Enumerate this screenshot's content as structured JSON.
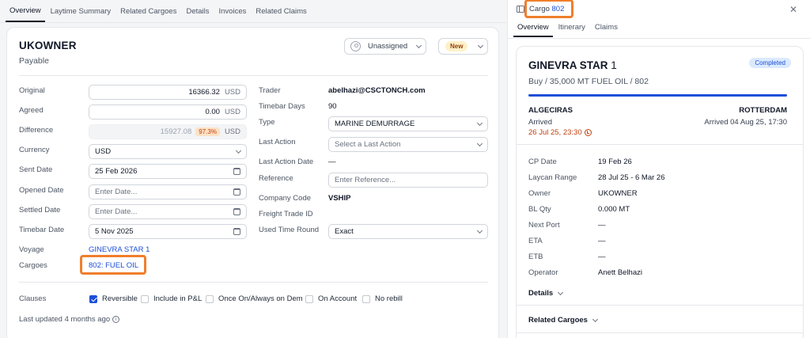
{
  "tabs": [
    "Overview",
    "Laytime Summary",
    "Related Cargoes",
    "Details",
    "Invoices",
    "Related Claims"
  ],
  "header": {
    "title": "UKOWNER",
    "subtitle": "Payable",
    "assignee": "Unassigned",
    "status": "New"
  },
  "form": {
    "original_label": "Original",
    "original_value": "16366.32",
    "original_unit": "USD",
    "agreed_label": "Agreed",
    "agreed_value": "0.00",
    "agreed_unit": "USD",
    "difference_label": "Difference",
    "difference_value": "15927.08",
    "difference_pct": "97.3%",
    "currency_label": "Currency",
    "currency_value": "USD",
    "sent_date_label": "Sent Date",
    "sent_date_value": "25 Feb 2026",
    "opened_date_label": "Opened Date",
    "opened_date_placeholder": "Enter Date...",
    "settled_date_label": "Settled Date",
    "settled_date_placeholder": "Enter Date...",
    "timebar_date_label": "Timebar Date",
    "timebar_date_value": "5 Nov 2025",
    "voyage_label": "Voyage",
    "voyage_value": "GINEVRA STAR 1",
    "cargoes_label": "Cargoes",
    "cargoes_value": "802: FUEL OIL",
    "trader_label": "Trader",
    "trader_value": "abelhazi@CSCTONCH.com",
    "timebar_days_label": "Timebar Days",
    "timebar_days_value": "90",
    "type_label": "Type",
    "type_value": "MARINE DEMURRAGE",
    "last_action_label": "Last Action",
    "last_action_placeholder": "Select a Last Action",
    "last_action_date_label": "Last Action Date",
    "last_action_date_value": "—",
    "reference_label": "Reference",
    "reference_placeholder": "Enter Reference...",
    "company_code_label": "Company Code",
    "company_code_value": "VSHIP",
    "freight_trade_id_label": "Freight Trade ID",
    "used_time_round_label": "Used Time Round",
    "used_time_round_value": "Exact"
  },
  "clauses": {
    "label": "Clauses",
    "items": [
      {
        "label": "Reversible",
        "checked": true
      },
      {
        "label": "Include in P&L",
        "checked": false
      },
      {
        "label": "Once On/Always on Dem",
        "checked": false
      },
      {
        "label": "On Account",
        "checked": false
      },
      {
        "label": "No rebill",
        "checked": false
      }
    ]
  },
  "last_updated": "Last updated 4 months ago",
  "panel": {
    "title_prefix": "Cargo",
    "title_link": "802",
    "tabs": [
      "Overview",
      "Itinerary",
      "Claims"
    ],
    "vessel": "GINEVRA STAR",
    "vessel_num": "1",
    "status": "Completed",
    "cargo_desc": "Buy / 35,000 MT FUEL OIL / 802",
    "from_port": "ALGECIRAS",
    "to_port": "ROTTERDAM",
    "from_status": "Arrived",
    "from_date": "26 Jul 25, 23:30",
    "to_status": "Arrived 04 Aug 25, 17:30",
    "details": [
      {
        "label": "CP Date",
        "value": "19 Feb 26"
      },
      {
        "label": "Laycan Range",
        "value": "28 Jul 25 - 6 Mar 26"
      },
      {
        "label": "Owner",
        "value": "UKOWNER"
      },
      {
        "label": "BL Qty",
        "value": "0.000 MT"
      },
      {
        "label": "Next Port",
        "value": "—"
      },
      {
        "label": "ETA",
        "value": "—"
      },
      {
        "label": "ETB",
        "value": "—"
      },
      {
        "label": "Operator",
        "value": "Anett Belhazi"
      }
    ],
    "details_section": "Details",
    "related_cargoes_section": "Related Cargoes"
  },
  "colors": {
    "accent": "#1d4ed8",
    "highlight": "#f07e2c",
    "warning": "#c2410c"
  }
}
